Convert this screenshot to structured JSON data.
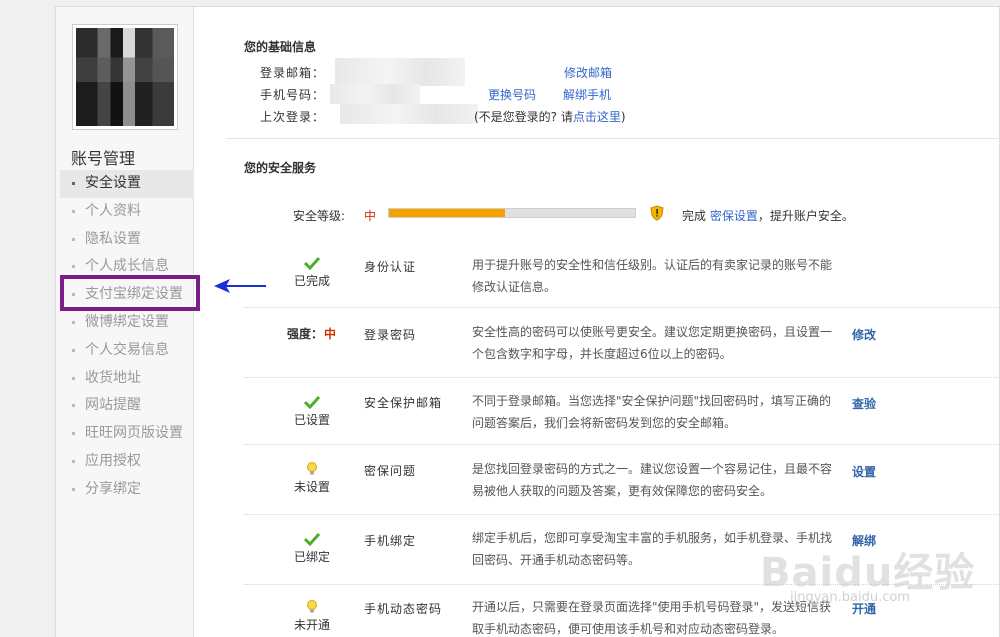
{
  "sidebar": {
    "title": "账号管理",
    "items": [
      {
        "label": "安全设置",
        "active": true
      },
      {
        "label": "个人资料"
      },
      {
        "label": "隐私设置"
      },
      {
        "label": "个人成长信息"
      },
      {
        "label": "支付宝绑定设置"
      },
      {
        "label": "微博绑定设置"
      },
      {
        "label": "个人交易信息"
      },
      {
        "label": "收货地址"
      },
      {
        "label": "网站提醒"
      },
      {
        "label": "旺旺网页版设置"
      },
      {
        "label": "应用授权"
      },
      {
        "label": "分享绑定"
      }
    ]
  },
  "basic": {
    "title": "您的基础信息",
    "email_label": "登录邮箱：",
    "phone_label": "手机号码：",
    "last_login_label": "上次登录：",
    "modify_email": "修改邮箱",
    "change_phone": "更换号码",
    "unbind_phone": "解绑手机",
    "not_you_prefix": "(不是您登录的? 请",
    "click_here": "点击这里",
    "not_you_suffix": ")"
  },
  "security": {
    "title": "您的安全服务",
    "level_label": "安全等级:",
    "level_value": "中",
    "level_fraction": 0.47,
    "level_hint_prefix": "完成",
    "level_hint_link": "密保设置",
    "level_hint_suffix": "，提升账户安全。",
    "items": [
      {
        "status": "已完成",
        "status_icon": "check-icon",
        "name": "身份认证",
        "desc": "用于提升账号的安全性和信任级别。认证后的有卖家记录的账号不能修改认证信息。",
        "action": ""
      },
      {
        "strength_label": "强度：",
        "strength_value": "中",
        "name": "登录密码",
        "desc": "安全性高的密码可以使账号更安全。建议您定期更换密码，且设置一个包含数字和字母，并长度超过6位以上的密码。",
        "action": "修改"
      },
      {
        "status": "已设置",
        "status_icon": "check-icon",
        "name": "安全保护邮箱",
        "desc": "不同于登录邮箱。当您选择\"安全保护问题\"找回密码时，填写正确的问题答案后，我们会将新密码发到您的安全邮箱。",
        "action": "查验"
      },
      {
        "status": "未设置",
        "status_icon": "bulb-icon",
        "name": "密保问题",
        "desc": "是您找回登录密码的方式之一。建议您设置一个容易记住，且最不容易被他人获取的问题及答案，更有效保障您的密码安全。",
        "action": "设置"
      },
      {
        "status": "已绑定",
        "status_icon": "check-icon",
        "name": "手机绑定",
        "desc": "绑定手机后，您即可享受淘宝丰富的手机服务，如手机登录、手机找回密码、开通手机动态密码等。",
        "action": "解绑"
      },
      {
        "status": "未开通",
        "status_icon": "bulb-icon",
        "name": "手机动态密码",
        "desc": "开通以后，只需要在登录页面选择\"使用手机号码登录\"，发送短信获取手机动态密码，便可使用该手机号和对应动态密码登录。",
        "action": "开通"
      }
    ]
  },
  "watermark": {
    "text": "Baidu经验",
    "sub": "jingyan.baidu.com"
  },
  "colors": {
    "highlight": "#7b1e87",
    "bar_fill": "#f5a200",
    "link": "#3366cc",
    "check": "#4caf28",
    "level": "#cc3300"
  }
}
